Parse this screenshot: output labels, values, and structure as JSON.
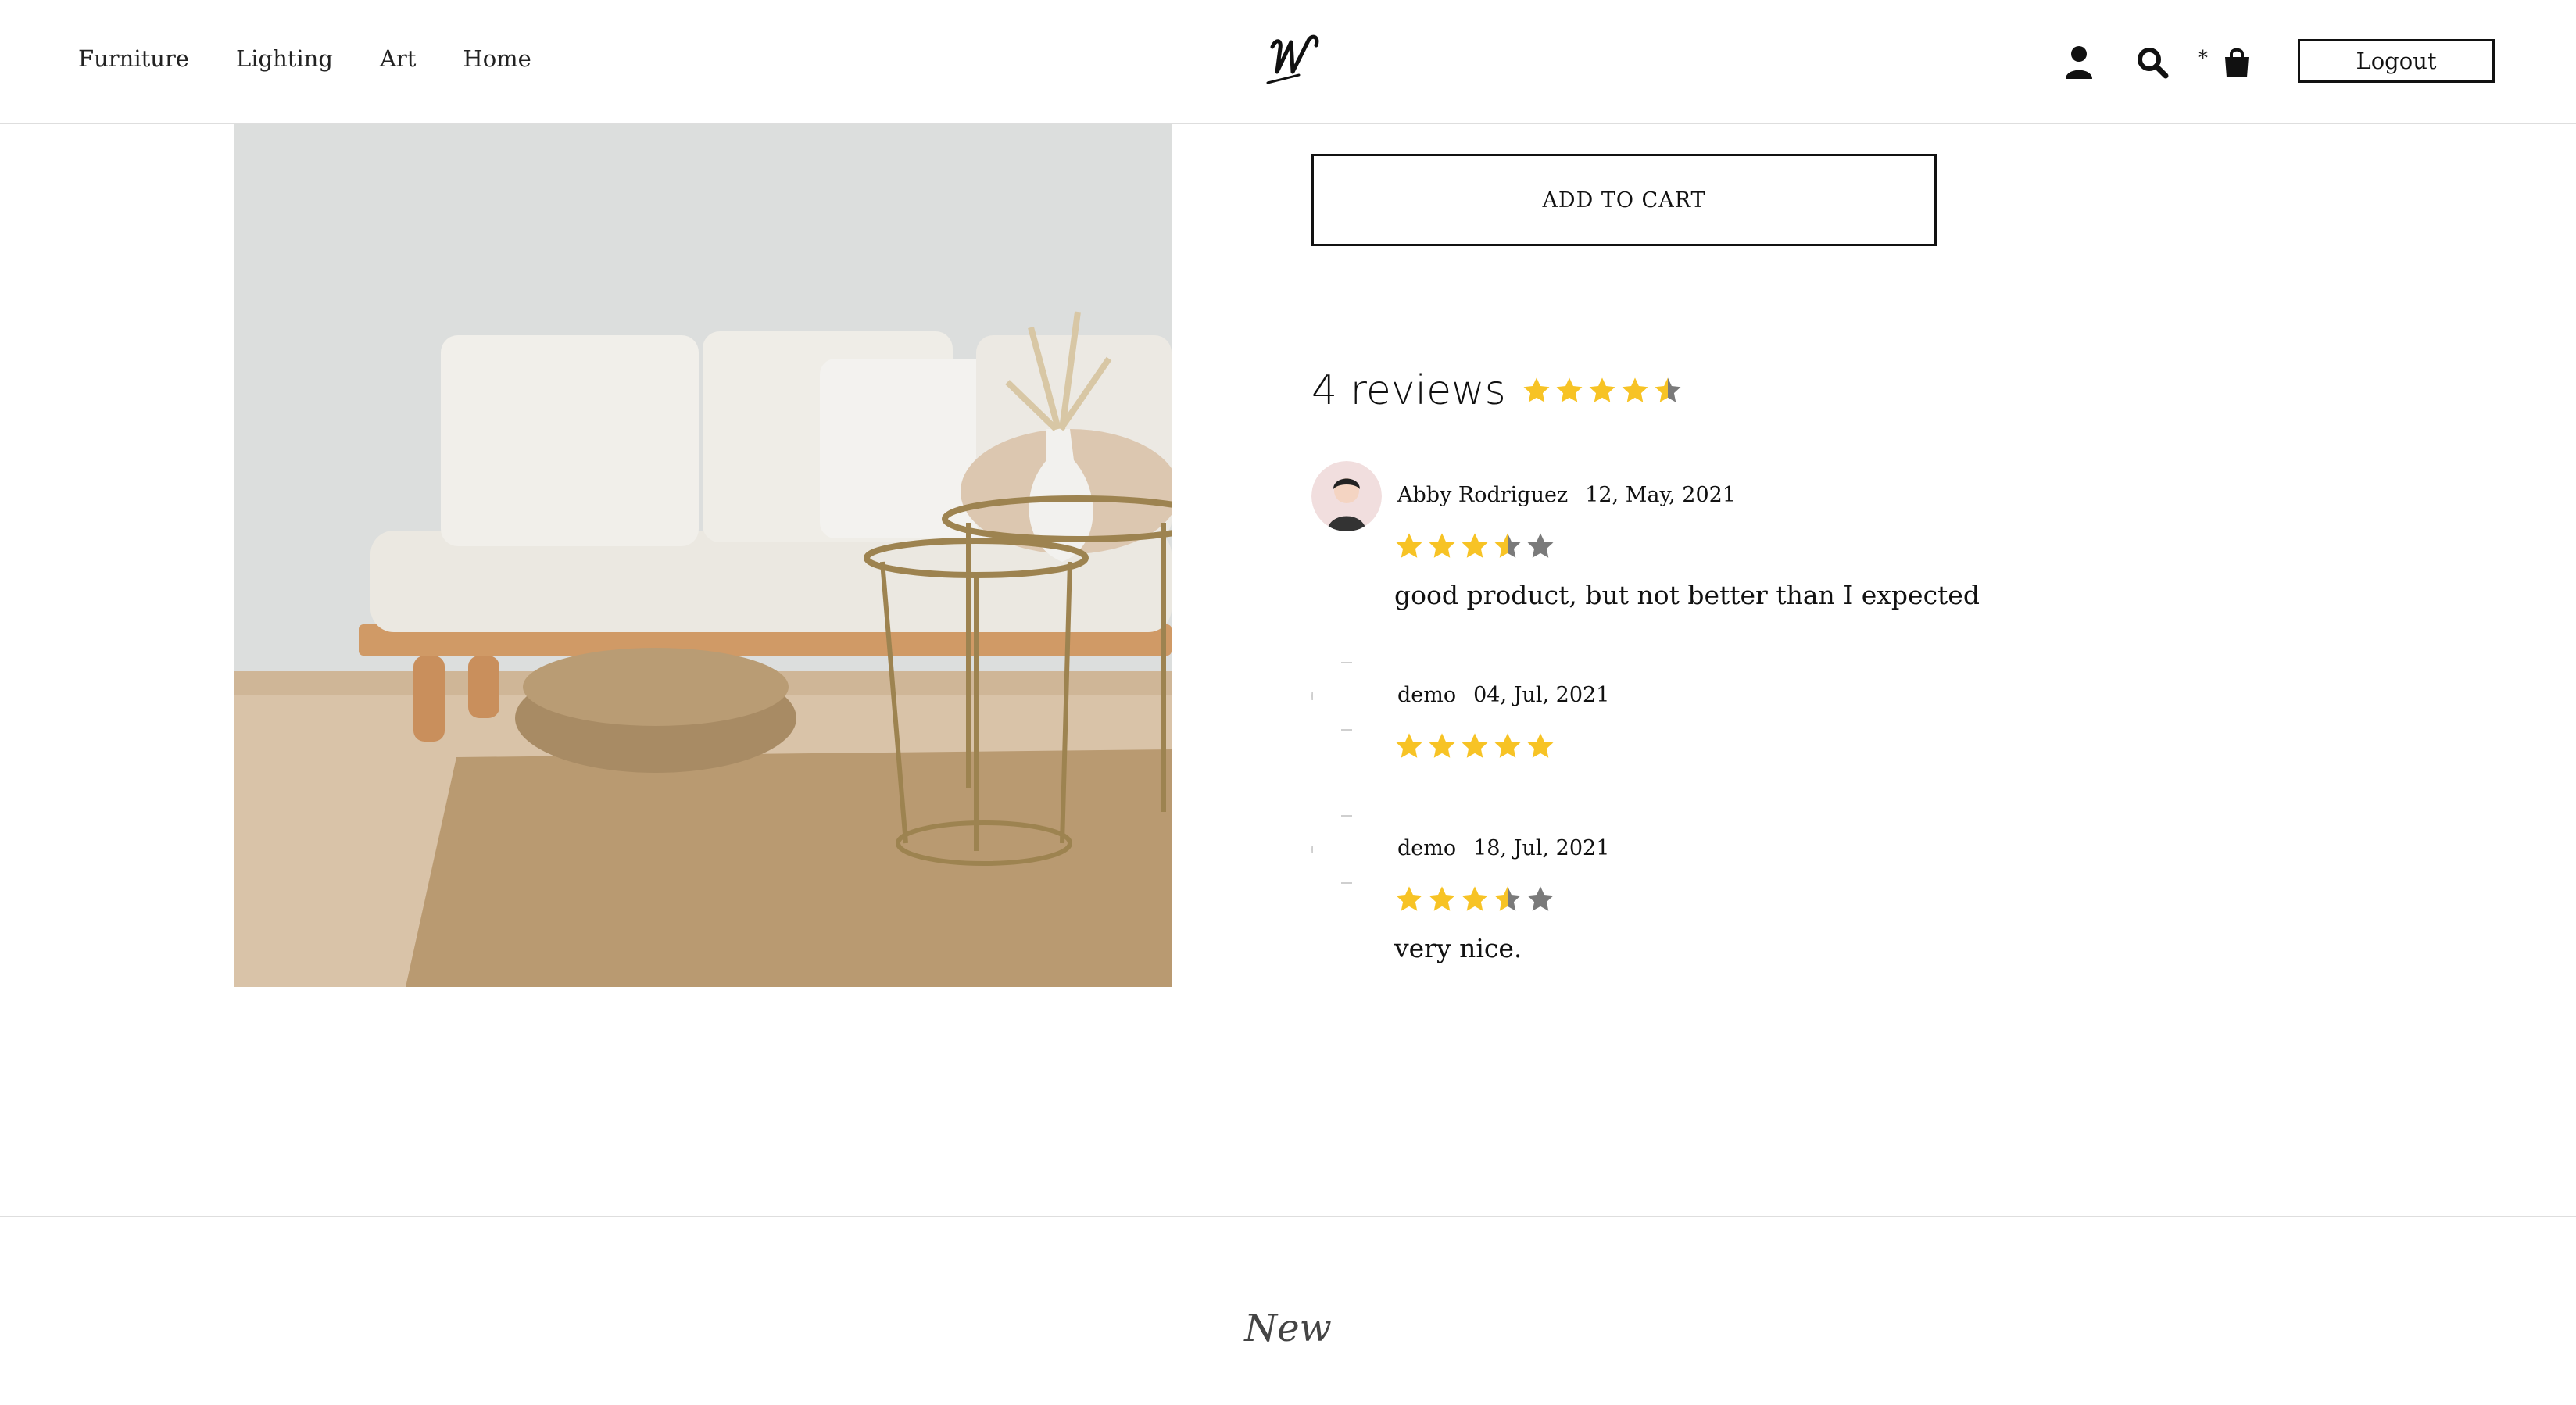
{
  "nav": {
    "items": [
      "Furniture",
      "Lighting",
      "Art",
      "Home"
    ]
  },
  "header": {
    "logo_text": "w",
    "cart_count": "*",
    "logout_label": "Logout",
    "icons": [
      "user-icon",
      "search-icon",
      "shopping-bag-icon"
    ]
  },
  "product": {
    "add_to_cart_label": "ADD TO CART"
  },
  "reviews": {
    "count_label": "4 reviews",
    "average_rating": 4.5,
    "items": [
      {
        "name": "Abby Rodriguez",
        "date": "12, May, 2021",
        "rating": 3.5,
        "text": "good product, but not better than I expected"
      },
      {
        "name": "demo",
        "date": "04, Jul, 2021",
        "rating": 5,
        "text": ""
      },
      {
        "name": "demo",
        "date": "18, Jul, 2021",
        "rating": 3.5,
        "text": "very nice."
      }
    ]
  },
  "colors": {
    "star_filled": "#F7C325",
    "star_empty": "#7a7a7a"
  },
  "sections": {
    "new_title": "New"
  }
}
